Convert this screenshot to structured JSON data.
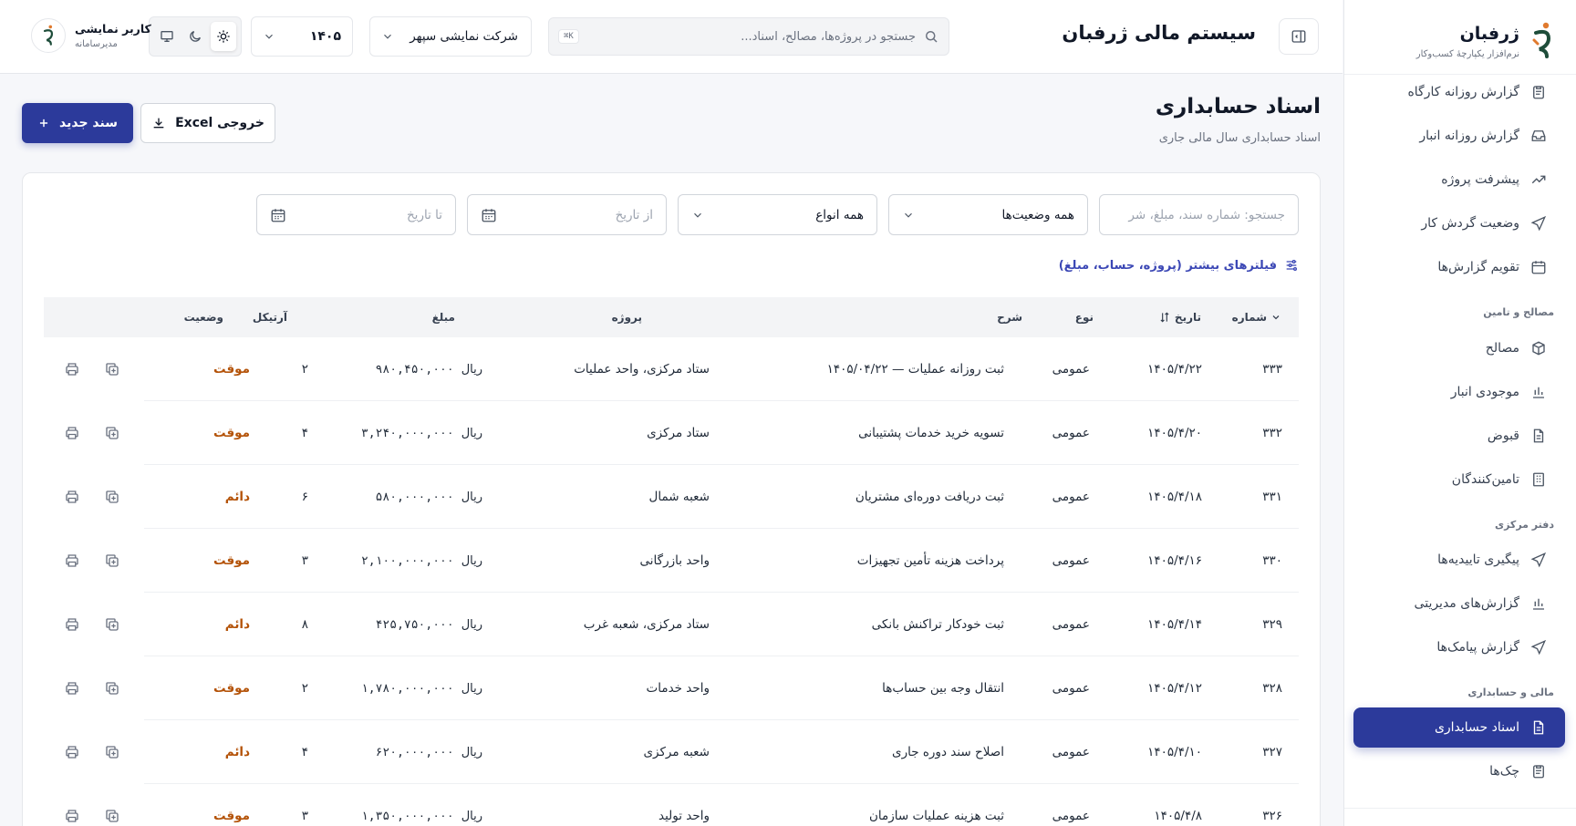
{
  "sidebar": {
    "brand_name": "ژرفبان",
    "brand_sub": "نرم‌افزار یکپارچهٔ کسب‌وکار",
    "items_top": [
      {
        "label": "گزارش روزانه کارگاه",
        "icon": "clipboard-icon"
      },
      {
        "label": "گزارش روزانه انبار",
        "icon": "inbox-icon"
      },
      {
        "label": "پیشرفت پروژه",
        "icon": "trend-up-icon"
      },
      {
        "label": "وضعیت گردش کار",
        "icon": "send-icon"
      },
      {
        "label": "تقویم گزارش‌ها",
        "icon": "calendar-icon"
      }
    ],
    "section_materials": "مصالح و تامین",
    "items_materials": [
      {
        "label": "مصالح",
        "icon": "box-icon"
      },
      {
        "label": "موجودی انبار",
        "icon": "bar-chart-icon"
      },
      {
        "label": "قبوض",
        "icon": "document-icon"
      },
      {
        "label": "تامین‌کنندگان",
        "icon": "building-icon"
      }
    ],
    "section_office": "دفتر مرکزی",
    "items_office": [
      {
        "label": "پیگیری تاییدیه‌ها",
        "icon": "send-icon"
      },
      {
        "label": "گزارش‌های مدیریتی",
        "icon": "bar-chart-icon"
      },
      {
        "label": "گزارش پیامک‌ها",
        "icon": "send-icon"
      }
    ],
    "section_finance": "مالی و حسابداری",
    "items_finance": [
      {
        "label": "اسناد حسابداری",
        "icon": "document-icon",
        "active": true
      },
      {
        "label": "چک‌ها",
        "icon": "clipboard-icon"
      }
    ]
  },
  "topbar": {
    "app_title": "سیستم مالی ژرفبان",
    "search_placeholder": "جستجو در پروژه‌ها، مصالح، اسناد...",
    "search_shortcut": "K⌘",
    "company": "شرکت نمایشی سپهر",
    "year": "۱۴۰۵",
    "user_name": "کاربر نمایشی",
    "user_role": "مدیرسامانه"
  },
  "page": {
    "title": "اسناد حسابداری",
    "subtitle": "اسناد حسابداری سال مالی جاری",
    "new_button": "سند جدید",
    "excel_button": "خروجی Excel"
  },
  "filters": {
    "search_placeholder": "جستجو: شماره سند، مبلغ، شر",
    "status_value": "همه وضعیت‌ها",
    "type_value": "همه انواع",
    "from_placeholder": "از تاریخ",
    "to_placeholder": "تا تاریخ",
    "more_filters": "فیلترهای بیشتر (پروژه، حساب، مبلغ)"
  },
  "table": {
    "headers": {
      "number": "شماره",
      "date": "تاریخ",
      "type": "نوع",
      "description": "شرح",
      "project": "پروژه",
      "amount": "مبلغ",
      "article": "آرتیکل",
      "status": "وضعیت"
    },
    "rows": [
      {
        "number": "۳۳۳",
        "date": "۱۴۰۵/۴/۲۲",
        "type": "عمومی",
        "description": "ثبت روزانه عملیات — ۱۴۰۵/۰۴/۲۲",
        "project": "ستاد مرکزی، واحد عملیات",
        "amount": "۹۸۰,۴۵۰,۰۰۰",
        "currency": "ریال",
        "article": "۲",
        "status": "موقت"
      },
      {
        "number": "۳۳۲",
        "date": "۱۴۰۵/۴/۲۰",
        "type": "عمومی",
        "description": "تسویه خرید خدمات پشتیبانی",
        "project": "ستاد مرکزی",
        "amount": "۳,۲۴۰,۰۰۰,۰۰۰",
        "currency": "ریال",
        "article": "۴",
        "status": "موقت"
      },
      {
        "number": "۳۳۱",
        "date": "۱۴۰۵/۴/۱۸",
        "type": "عمومی",
        "description": "ثبت دریافت دوره‌ای مشتریان",
        "project": "شعبه شمال",
        "amount": "۵۸۰,۰۰۰,۰۰۰",
        "currency": "ریال",
        "article": "۶",
        "status": "دائم"
      },
      {
        "number": "۳۳۰",
        "date": "۱۴۰۵/۴/۱۶",
        "type": "عمومی",
        "description": "پرداخت هزینه تأمین تجهیزات",
        "project": "واحد بازرگانی",
        "amount": "۲,۱۰۰,۰۰۰,۰۰۰",
        "currency": "ریال",
        "article": "۳",
        "status": "موقت"
      },
      {
        "number": "۳۲۹",
        "date": "۱۴۰۵/۴/۱۴",
        "type": "عمومی",
        "description": "ثبت خودکار تراکنش بانکی",
        "project": "ستاد مرکزی، شعبه غرب",
        "amount": "۴۲۵,۷۵۰,۰۰۰",
        "currency": "ریال",
        "article": "۸",
        "status": "دائم"
      },
      {
        "number": "۳۲۸",
        "date": "۱۴۰۵/۴/۱۲",
        "type": "عمومی",
        "description": "انتقال وجه بین حساب‌ها",
        "project": "واحد خدمات",
        "amount": "۱,۷۸۰,۰۰۰,۰۰۰",
        "currency": "ریال",
        "article": "۲",
        "status": "موقت"
      },
      {
        "number": "۳۲۷",
        "date": "۱۴۰۵/۴/۱۰",
        "type": "عمومی",
        "description": "اصلاح سند دوره جاری",
        "project": "شعبه مرکزی",
        "amount": "۶۲۰,۰۰۰,۰۰۰",
        "currency": "ریال",
        "article": "۴",
        "status": "دائم"
      },
      {
        "number": "۳۲۶",
        "date": "۱۴۰۵/۴/۸",
        "type": "عمومی",
        "description": "ثبت هزینه عملیات سازمان",
        "project": "واحد تولید",
        "amount": "۱,۳۵۰,۰۰۰,۰۰۰",
        "currency": "ریال",
        "article": "۳",
        "status": "موقت"
      }
    ]
  },
  "colors": {
    "primary": "#2c3a9b",
    "status": "#b45309",
    "brand_accent": "#e07a2e",
    "brand_dark": "#1e4d3a"
  }
}
